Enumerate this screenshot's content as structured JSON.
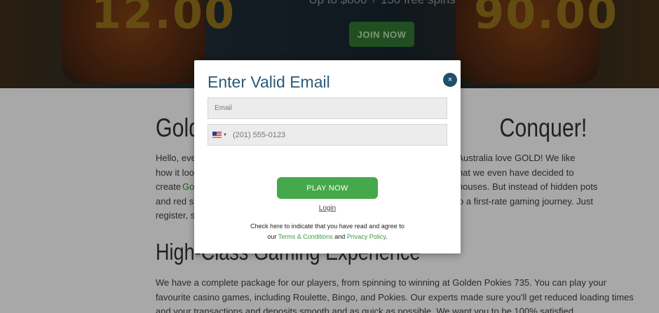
{
  "hero": {
    "left_number": "12.00",
    "right_number": "90.00",
    "offer_text": "Up to $800 + 150 free spins",
    "join_label": "JOIN NOW"
  },
  "content": {
    "heading_left": "Gold",
    "heading_right": "Conquer!",
    "para1": [
      {
        "left": "Hello, eve",
        "right": "ve in Australia love GOLD! We like"
      },
      {
        "left": "how it loo",
        "right": "ch that we even have decided to"
      },
      {
        "left": "create ",
        "green": "Go",
        "right": "g houses. But instead of hidden pots"
      },
      {
        "left": "and red so",
        "right": "o a first-rate gaming journey. Just"
      },
      {
        "left": "register, sv",
        "right": ""
      }
    ],
    "heading2": "High-Class Gaming Experience",
    "para2": [
      "We have a complete package for our players, from spinning to winning at Golden Pokies 735. You can play your",
      "favourite casino games, including Roulette, Bingo, and Pokies. Our experts made sure you'll get reduced loading times",
      "and your transactions and deposits smooth and as quick as possible. We want you to be 100% satisfied."
    ]
  },
  "modal": {
    "title": "Enter Valid Email",
    "close_glyph": "×",
    "email_placeholder": "Email",
    "phone_placeholder": "(201) 555-0123",
    "play_label": "PLAY NOW",
    "login_label": "Login",
    "terms_line1": "Check here to indicate that you have read and agree to",
    "terms_our": "our ",
    "terms_link": "Terms & Conditions",
    "terms_and": " and ",
    "privacy_link": "Privacy Policy",
    "terms_end": "."
  },
  "colors": {
    "accent_green": "#45a84a",
    "title_blue": "#2b5a78",
    "close_bg": "#1f4f6e"
  }
}
